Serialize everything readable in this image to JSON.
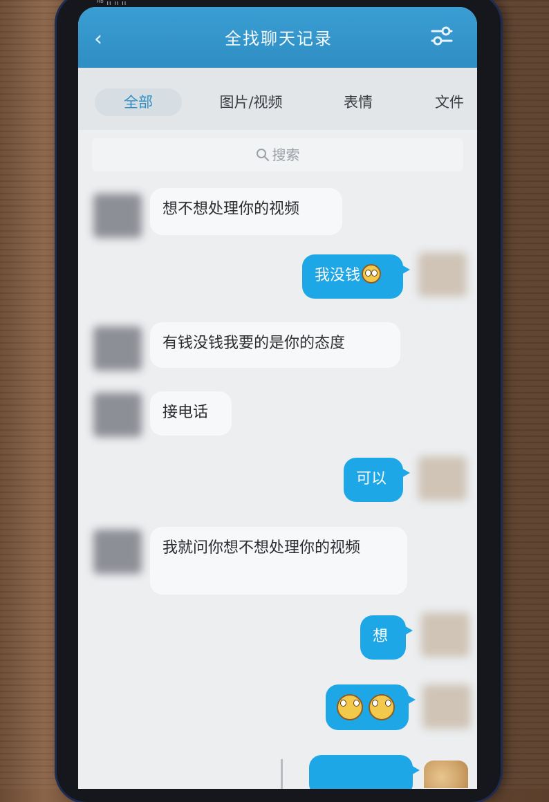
{
  "header": {
    "title": "全找聊天记录",
    "back_icon": "chevron-left-icon",
    "filter_icon": "filter-sliders-icon"
  },
  "tabs": [
    {
      "label": "全部",
      "active": true
    },
    {
      "label": "图片/视频",
      "active": false
    },
    {
      "label": "表情",
      "active": false
    },
    {
      "label": "文件",
      "active": false
    }
  ],
  "search": {
    "placeholder": "搜索",
    "icon": "search-icon"
  },
  "messages": [
    {
      "side": "left",
      "text": "想不想处理你的视频"
    },
    {
      "side": "right",
      "text": "我没钱",
      "emoji_count": 1
    },
    {
      "side": "left",
      "text": "有钱没钱我要的是你的态度"
    },
    {
      "side": "left",
      "text": "接电话"
    },
    {
      "side": "right",
      "text": "可以"
    },
    {
      "side": "left",
      "text": "我就问你想不想处理你的视频"
    },
    {
      "side": "right",
      "text": "想"
    },
    {
      "side": "right",
      "text": "",
      "emoji_count": 2
    }
  ],
  "colors": {
    "header": "#2f8ec4",
    "bubble_right": "#1ea7e6",
    "bubble_left": "#f7f8f9",
    "background": "#eceef0"
  }
}
